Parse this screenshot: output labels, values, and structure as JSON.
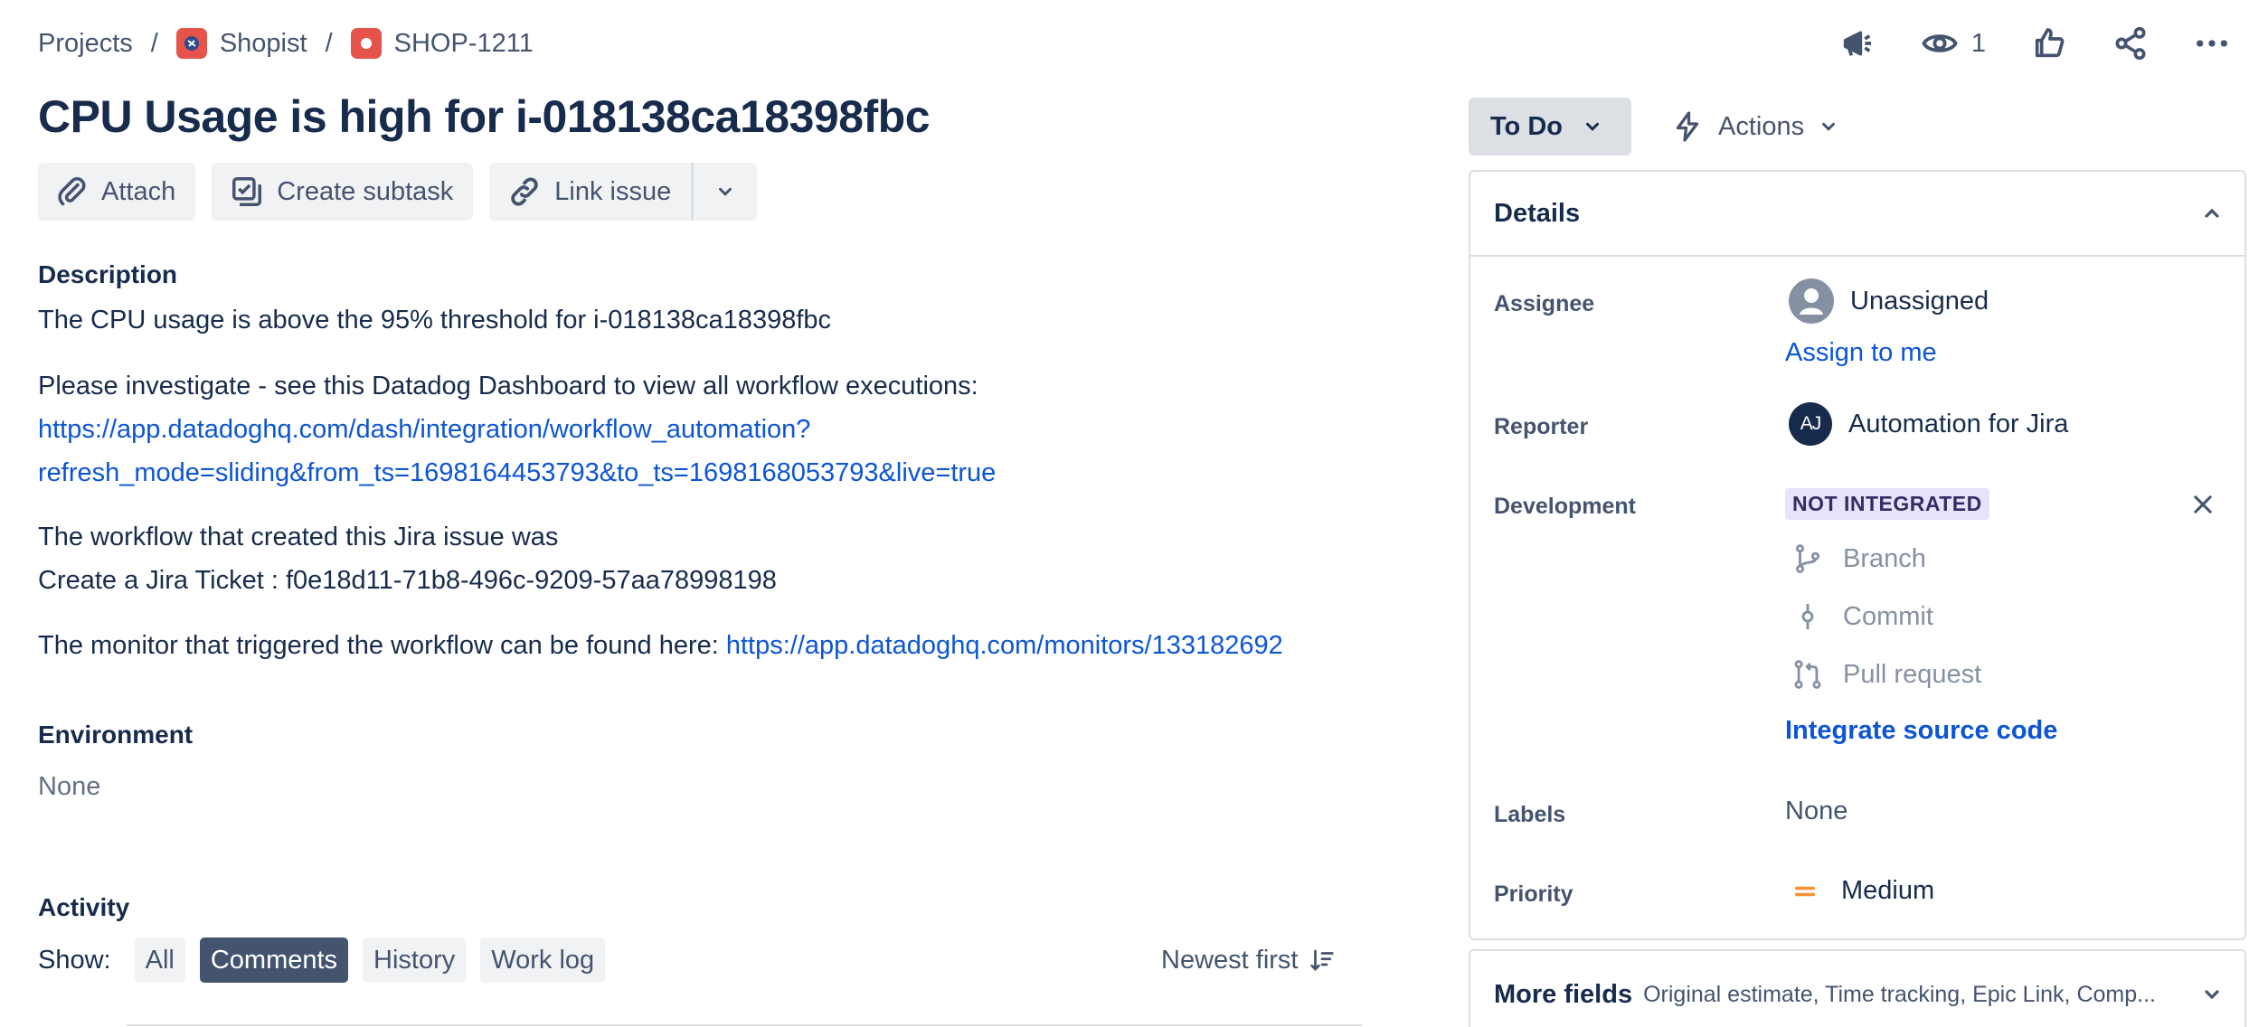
{
  "breadcrumb": {
    "projects": "Projects",
    "sep": "/",
    "project": "Shopist",
    "issue_key": "SHOP-1211"
  },
  "top_actions": {
    "watchers_count": "1"
  },
  "issue": {
    "title": "CPU Usage is high for i-018138ca18398fbc"
  },
  "toolbar": {
    "attach": "Attach",
    "create_subtask": "Create subtask",
    "link_issue": "Link issue"
  },
  "description": {
    "label": "Description",
    "line1": "The CPU usage is above the 95% threshold for i-018138ca18398fbc",
    "line2": "Please investigate - see this Datadog Dashboard to view all workflow executions:",
    "link_part1": "https://app.datadoghq.com/dash/integration/workflow_automation?",
    "link_part2": "refresh_mode=sliding&from_ts=1698164453793&to_ts=1698168053793&live=true",
    "line3": "The workflow that created this Jira issue was",
    "line4": "Create a Jira Ticket : f0e18d11-71b8-496c-9209-57aa78998198",
    "line5_prefix": "The monitor that triggered the workflow can be found here: ",
    "monitor_link": "https://app.datadoghq.com/monitors/133182692"
  },
  "environment": {
    "label": "Environment",
    "value": "None"
  },
  "activity": {
    "label": "Activity",
    "show_label": "Show:",
    "filters": [
      "All",
      "Comments",
      "History",
      "Work log"
    ],
    "active_filter": "Comments",
    "sort": "Newest first"
  },
  "status": {
    "label": "To Do"
  },
  "actions": {
    "label": "Actions"
  },
  "details": {
    "title": "Details",
    "assignee_label": "Assignee",
    "assignee_value": "Unassigned",
    "assign_to_me": "Assign to me",
    "reporter_label": "Reporter",
    "reporter_initials": "AJ",
    "reporter_value": "Automation for Jira",
    "development_label": "Development",
    "dev_badge": "NOT INTEGRATED",
    "dev_items": [
      "Branch",
      "Commit",
      "Pull request"
    ],
    "integrate_link": "Integrate source code",
    "labels_label": "Labels",
    "labels_value": "None",
    "priority_label": "Priority",
    "priority_value": "Medium"
  },
  "more_fields": {
    "title": "More fields",
    "summary": "Original estimate, Time tracking, Epic Link, Comp..."
  },
  "colors": {
    "link": "#0c55d4",
    "text": "#172b4d",
    "priority_medium": "#f79232",
    "active_chip": "#44546f",
    "badge_bg": "#e9e2fb"
  }
}
